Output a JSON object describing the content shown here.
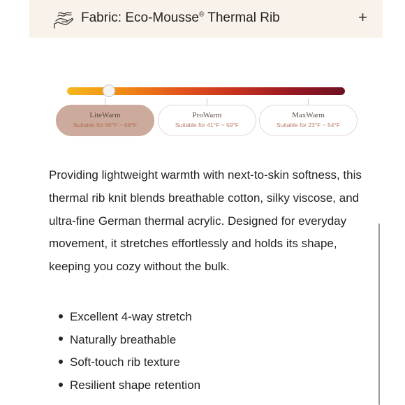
{
  "header": {
    "title_prefix": "Fabric: Eco-Mousse",
    "title_mark": "®",
    "title_suffix": " Thermal Rib",
    "toggle_label": "+",
    "icon": "fabric-hand-icon"
  },
  "warmth": {
    "slider_position": 0.15,
    "levels": [
      {
        "name": "LiteWarm",
        "range": "Suitable for 50°F ~ 68°F",
        "selected": true
      },
      {
        "name": "ProWarm",
        "range": "Suitable for 41°F ~ 59°F",
        "selected": false
      },
      {
        "name": "MaxWarm",
        "range": "Suitable for 23°F ~ 54°F",
        "selected": false
      }
    ],
    "gradient_colors": [
      "#f5b91c",
      "#f08a14",
      "#e4561c",
      "#c8331f",
      "#9a1a23",
      "#6e1021"
    ]
  },
  "description": "Providing lightweight warmth with next-to-skin softness, this thermal rib knit blends breathable cotton, silky viscose, and ultra-fine German thermal acrylic. Designed for everyday movement, it stretches effortlessly and holds its shape, keeping you cozy without the bulk.",
  "features": [
    "Excellent 4-way stretch",
    "Naturally breathable",
    "Soft-touch rib texture",
    "Resilient shape retention"
  ],
  "colors": {
    "header_bg": "#f8f2ea",
    "selected_level_bg": "#cdab9c",
    "level_range_text": "#b87a6a"
  }
}
